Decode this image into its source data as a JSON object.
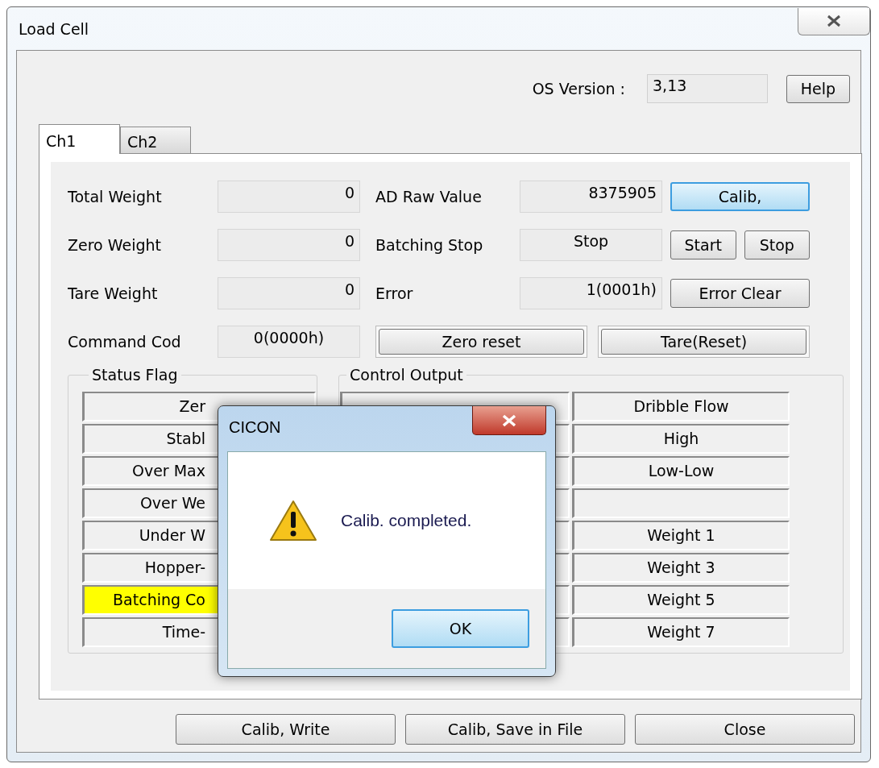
{
  "window": {
    "title": "Load Cell"
  },
  "os_version": {
    "label": "OS Version :",
    "value": "3,13"
  },
  "help_button": "Help",
  "tabs": [
    {
      "label": "Ch1",
      "selected": true
    },
    {
      "label": "Ch2",
      "selected": false
    }
  ],
  "rows": [
    {
      "label": "Total Weight",
      "field": {
        "text": "0",
        "kind": "number"
      },
      "label_2": "AD Raw Value",
      "field_2": {
        "text": "8375905",
        "kind": "number"
      },
      "buttons": [
        {
          "label": "Calib,",
          "focused": true
        }
      ]
    },
    {
      "label": "Zero Weight",
      "field": {
        "text": "0",
        "kind": "number"
      },
      "label_2": "Batching Stop",
      "field_2": {
        "text": "Stop",
        "kind": "text"
      },
      "buttons": [
        {
          "label": "Start",
          "focused": false
        },
        {
          "label": "Stop",
          "focused": false
        }
      ]
    },
    {
      "label": "Tare Weight",
      "field": {
        "text": "0",
        "kind": "number"
      },
      "label_2": "Error",
      "field_2": {
        "text": "1(0001h)",
        "kind": "number"
      },
      "buttons": [
        {
          "label": "Error Clear",
          "focused": false
        }
      ]
    },
    {
      "label": "Command Cod",
      "field": {
        "text": "0(0000h)",
        "kind": "text"
      },
      "buttons": [
        {
          "label": "Zero reset",
          "focused": false
        },
        {
          "label": "Tare(Reset)",
          "focused": false
        }
      ]
    }
  ],
  "status_flag": {
    "title": "Status Flag",
    "items": [
      {
        "label": "Zer",
        "active": false
      },
      {
        "label": "Stabl",
        "active": false
      },
      {
        "label": "Over Max",
        "active": false
      },
      {
        "label": "Over We",
        "active": false
      },
      {
        "label": "Under W",
        "active": false
      },
      {
        "label": "Hopper-",
        "active": false
      },
      {
        "label": "Batching Co",
        "active": true
      },
      {
        "label": "Time-",
        "active": false
      }
    ]
  },
  "control_output": {
    "title": "Control Output",
    "column_2": [
      {
        "kind": "label",
        "label": "Dribble Flow"
      },
      {
        "kind": "label",
        "label": "High"
      },
      {
        "kind": "label",
        "label": "Low-Low"
      },
      {
        "kind": "empty"
      },
      {
        "kind": "label",
        "label": "Weight 1"
      },
      {
        "kind": "label",
        "label": "Weight 3"
      },
      {
        "kind": "label",
        "label": "Weight 5"
      },
      {
        "kind": "label",
        "label": "Weight 7"
      }
    ]
  },
  "bottom_buttons": [
    "Calib, Write",
    "Calib, Save in File",
    "Close"
  ],
  "message_box": {
    "title": "CICON",
    "message": "Calib. completed.",
    "button": {
      "label": "OK",
      "focused": true
    }
  }
}
